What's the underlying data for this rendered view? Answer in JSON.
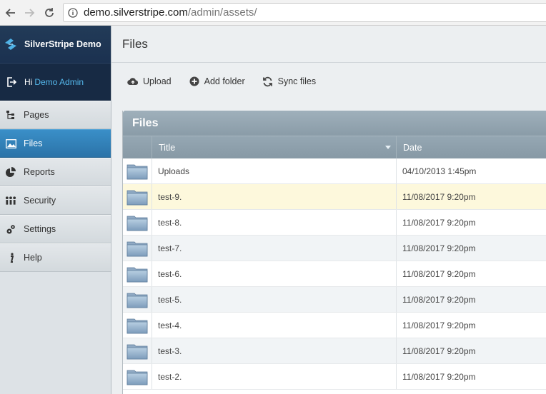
{
  "browser": {
    "url_host": "demo.silverstripe.com",
    "url_path": "/admin/assets/",
    "icons": [
      "back-arrow-icon",
      "forward-arrow-icon",
      "reload-icon",
      "info-icon"
    ]
  },
  "sidebar": {
    "brand": "SilverStripe Demo",
    "greeting": "Hi",
    "user_name": "Demo Admin",
    "items": [
      {
        "label": "Pages",
        "icon": "sitetree-icon",
        "active": false
      },
      {
        "label": "Files",
        "icon": "image-icon",
        "active": true
      },
      {
        "label": "Reports",
        "icon": "pie-chart-icon",
        "active": false
      },
      {
        "label": "Security",
        "icon": "users-icon",
        "active": false
      },
      {
        "label": "Settings",
        "icon": "gears-icon",
        "active": false
      },
      {
        "label": "Help",
        "icon": "info-italic-icon",
        "active": false
      }
    ]
  },
  "main": {
    "page_title": "Files",
    "toolbar": {
      "upload": "Upload",
      "add_folder": "Add folder",
      "sync_files": "Sync files"
    },
    "grid": {
      "title": "Files",
      "columns": [
        "Title",
        "Date"
      ],
      "rows": [
        {
          "title": "Uploads",
          "date": "04/10/2013 1:45pm"
        },
        {
          "title": "test-9.",
          "date": "11/08/2017 9:20pm"
        },
        {
          "title": "test-8.",
          "date": "11/08/2017 9:20pm"
        },
        {
          "title": "test-7.",
          "date": "11/08/2017 9:20pm"
        },
        {
          "title": "test-6.",
          "date": "11/08/2017 9:20pm"
        },
        {
          "title": "test-5.",
          "date": "11/08/2017 9:20pm"
        },
        {
          "title": "test-4.",
          "date": "11/08/2017 9:20pm"
        },
        {
          "title": "test-3.",
          "date": "11/08/2017 9:20pm"
        },
        {
          "title": "test-2.",
          "date": "11/08/2017 9:20pm"
        }
      ]
    }
  },
  "colors": {
    "brand_bg": "#1b3150",
    "active_item": "#2b73a8",
    "user_link": "#55b8ec",
    "row_hover": "#fdf8dc"
  }
}
